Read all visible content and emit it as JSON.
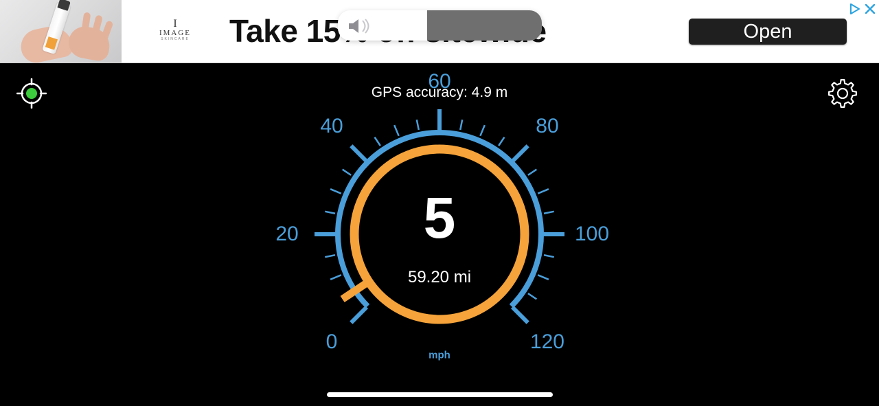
{
  "ad": {
    "brand": "IMAGE",
    "brand_sub": "SKINCARE",
    "headline": "Take 15% off sitewide",
    "open_label": "Open"
  },
  "gps": {
    "accuracy_text": "GPS accuracy: 4.9 m",
    "status_color": "#3ccb3c"
  },
  "speedometer": {
    "speed": "5",
    "distance": "59.20 mi",
    "unit": "mph",
    "scale_min": 0,
    "scale_max": 120,
    "major_labels": [
      "0",
      "20",
      "40",
      "60",
      "80",
      "100",
      "120"
    ],
    "needle_value": 5,
    "colors": {
      "scale": "#4a9ed9",
      "ring": "#f5a33a",
      "text": "#ffffff",
      "background": "#000000"
    }
  },
  "icons": {
    "gps": "crosshair-icon",
    "settings": "gear-icon",
    "volume": "speaker-muted-icon",
    "adchoices": "adchoices-icon",
    "close": "close-icon"
  }
}
